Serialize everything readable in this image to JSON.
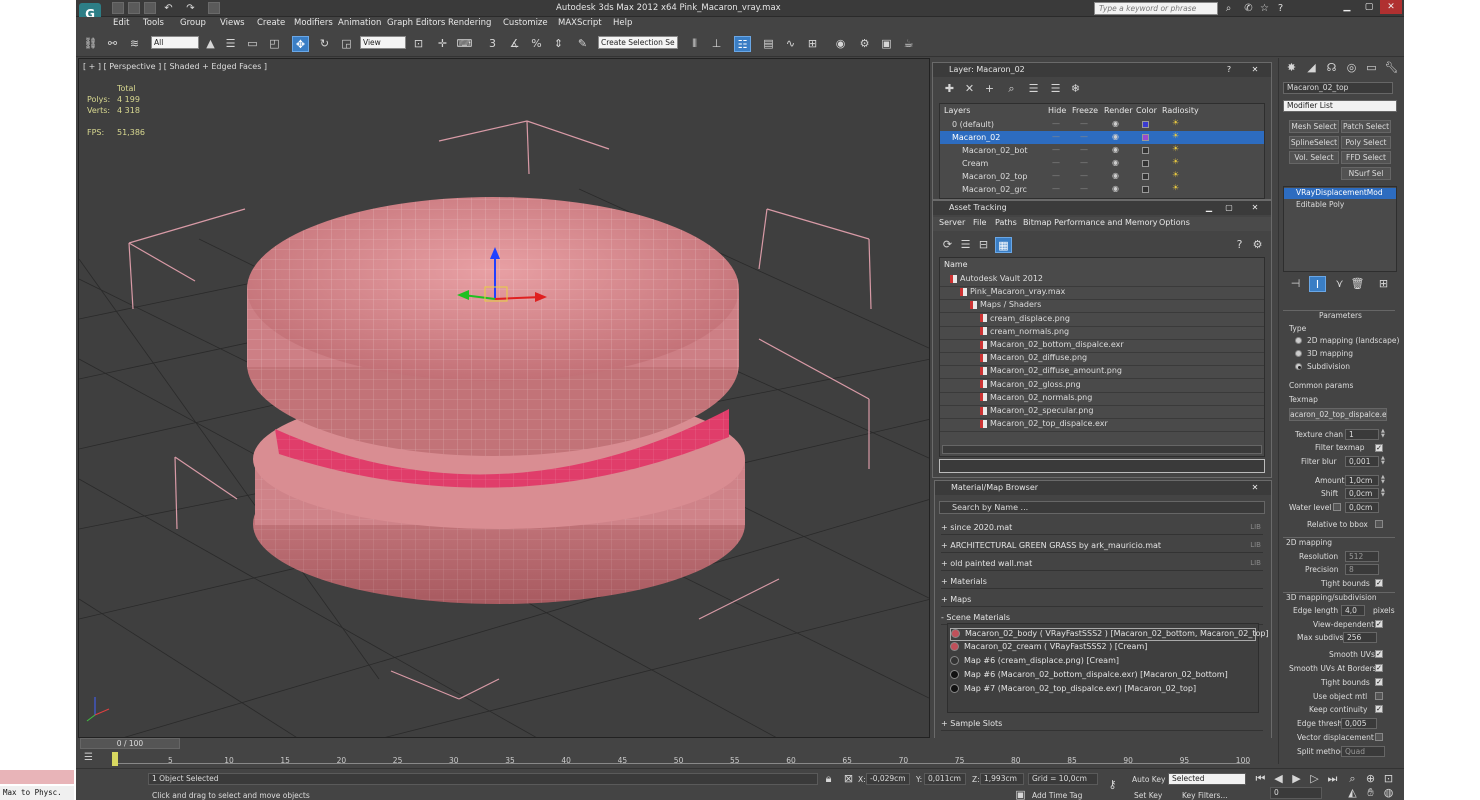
{
  "app": {
    "title": "Autodesk 3ds Max  2012 x64      Pink_Macaron_vray.max",
    "search_placeholder": "Type a keyword or phrase",
    "logo": "G"
  },
  "menu": [
    "Edit",
    "Tools",
    "Group",
    "Views",
    "Create",
    "Modifiers",
    "Animation",
    "Graph Editors",
    "Rendering",
    "Customize",
    "MAXScript",
    "Help"
  ],
  "toolbar": {
    "filter_value": "All",
    "ref_coord_value": "View",
    "selection_set_value": "Create Selection Se"
  },
  "viewport": {
    "label": "[ + ] [ Perspective ] [ Shaded + Edged Faces ]",
    "stats": {
      "total_label": "Total",
      "polys_label": "Polys:",
      "polys_value": "4 199",
      "verts_label": "Verts:",
      "verts_value": "4 318",
      "fps_label": "FPS:",
      "fps_value": "51,386"
    }
  },
  "layer_panel": {
    "title": "Layer: Macaron_02",
    "columns": [
      "Layers",
      "Hide",
      "Freeze",
      "Render",
      "Color",
      "Radiosity"
    ],
    "rows": [
      {
        "name": "0 (default)",
        "indent": 0,
        "selected": false,
        "color": "#3a3ad0"
      },
      {
        "name": "Macaron_02",
        "indent": 0,
        "selected": true,
        "color": "#9a4ad0"
      },
      {
        "name": "Macaron_02_bot",
        "indent": 1,
        "selected": false,
        "color": "#333333"
      },
      {
        "name": "Cream",
        "indent": 1,
        "selected": false,
        "color": "#333333"
      },
      {
        "name": "Macaron_02_top",
        "indent": 1,
        "selected": false,
        "color": "#333333"
      },
      {
        "name": "Macaron_02_grc",
        "indent": 1,
        "selected": false,
        "color": "#333333"
      }
    ]
  },
  "asset_panel": {
    "title": "Asset Tracking",
    "menu": [
      "Server",
      "File",
      "Paths",
      "Bitmap Performance and Memory",
      "Options"
    ],
    "column": "Name",
    "rows": [
      {
        "name": "Autodesk Vault 2012",
        "indent": 1
      },
      {
        "name": "Pink_Macaron_vray.max",
        "indent": 2
      },
      {
        "name": "Maps / Shaders",
        "indent": 3
      },
      {
        "name": "cream_displace.png",
        "indent": 4
      },
      {
        "name": "cream_normals.png",
        "indent": 4
      },
      {
        "name": "Macaron_02_bottom_dispalce.exr",
        "indent": 4
      },
      {
        "name": "Macaron_02_diffuse.png",
        "indent": 4
      },
      {
        "name": "Macaron_02_diffuse_amount.png",
        "indent": 4
      },
      {
        "name": "Macaron_02_gloss.png",
        "indent": 4
      },
      {
        "name": "Macaron_02_normals.png",
        "indent": 4
      },
      {
        "name": "Macaron_02_specular.png",
        "indent": 4
      },
      {
        "name": "Macaron_02_top_dispalce.exr",
        "indent": 4
      }
    ]
  },
  "material_browser": {
    "title": "Material/Map Browser",
    "search_placeholder": "Search by Name ...",
    "libraries": [
      {
        "label": "+ since 2020.mat",
        "lib": "LIB"
      },
      {
        "label": "+ ARCHITECTURAL GREEN GRASS by ark_mauricio.mat",
        "lib": "LIB"
      },
      {
        "label": "+ old painted wall.mat",
        "lib": "LIB"
      },
      {
        "label": "+ Materials",
        "lib": ""
      },
      {
        "label": "+ Maps",
        "lib": ""
      },
      {
        "label": "- Scene Materials",
        "lib": ""
      }
    ],
    "scene_materials": [
      {
        "label": "Macaron_02_body  ( VRayFastSSS2 ) [Macaron_02_bottom, Macaron_02_top]",
        "swatch": "#c0505a"
      },
      {
        "label": "Macaron_02_cream  ( VRayFastSSS2 ) [Cream]",
        "swatch": "#c0505a"
      },
      {
        "label": "Map #6 (cream_displace.png) [Cream]",
        "swatch": "#333333"
      },
      {
        "label": "Map #6 (Macaron_02_bottom_dispalce.exr) [Macaron_02_bottom]",
        "swatch": "#111111"
      },
      {
        "label": "Map #7 (Macaron_02_top_dispalce.exr) [Macaron_02_top]",
        "swatch": "#111111"
      }
    ],
    "sample_slots": "+ Sample Slots"
  },
  "command_panel": {
    "object_name": "Macaron_02_top",
    "modifier_list": "Modifier List",
    "buttons": [
      "Mesh Select",
      "Patch Select",
      "SplineSelect",
      "Poly Select",
      "Vol. Select",
      "FFD Select",
      "NSurf Sel"
    ],
    "stack": [
      {
        "label": "VRayDisplacementMod",
        "selected": true
      },
      {
        "label": "Editable Poly",
        "selected": false
      }
    ],
    "parameters": {
      "section": "Parameters",
      "type_label": "Type",
      "type_options": [
        "2D mapping (landscape)",
        "3D mapping",
        "Subdivision"
      ],
      "type_selected": 2,
      "common_label": "Common params",
      "texmap_label": "Texmap",
      "texmap_value": "acaron_02_top_dispalce.exr)",
      "texture_chan_label": "Texture chan",
      "texture_chan_value": "1",
      "filter_texmap_label": "Filter texmap",
      "filter_blur_label": "Filter blur",
      "filter_blur_value": "0,001",
      "amount_label": "Amount",
      "amount_value": "1,0cm",
      "shift_label": "Shift",
      "shift_value": "0,0cm",
      "water_level_label": "Water level",
      "water_level_value": "0,0cm",
      "relative_bbox_label": "Relative to bbox",
      "mapping2d_label": "2D mapping",
      "resolution_label": "Resolution",
      "resolution_value": "512",
      "precision_label": "Precision",
      "precision_value": "8",
      "tight_bounds_label": "Tight bounds",
      "mapping3d_label": "3D mapping/subdivision",
      "edge_length_label": "Edge length",
      "edge_length_value": "4,0",
      "pixels_label": "pixels",
      "view_dependent_label": "View-dependent",
      "max_subdivs_label": "Max subdivs",
      "max_subdivs_value": "256",
      "smooth_uvs_label": "Smooth UVs",
      "smooth_uvs_borders_label": "Smooth UVs At Borders",
      "tight_bounds2_label": "Tight bounds",
      "use_object_mtl_label": "Use object mtl",
      "keep_continuity_label": "Keep continuity",
      "edge_thresh_label": "Edge thresh",
      "edge_thresh_value": "0,005",
      "vector_disp_label": "Vector displacement",
      "split_method_label": "Split method",
      "split_method_value": "Quad"
    }
  },
  "timeline": {
    "frame": "0 / 100",
    "ticks": [
      "5",
      "10",
      "15",
      "20",
      "25",
      "30",
      "35",
      "40",
      "45",
      "50",
      "55",
      "60",
      "65",
      "70",
      "75",
      "80",
      "85",
      "90",
      "95",
      "100"
    ]
  },
  "status": {
    "maxscript": "Max to Physc.",
    "selected": "1 Object Selected",
    "prompt": "Click and drag to select and move objects",
    "x_label": "X:",
    "x_value": "-0,029cm",
    "y_label": "Y:",
    "y_value": "0,011cm",
    "z_label": "Z:",
    "z_value": "1,993cm",
    "grid": "Grid = 10,0cm",
    "add_time_tag": "Add Time Tag",
    "auto_key": "Auto Key",
    "set_key": "Set Key",
    "selected_dropdown": "Selected",
    "key_filters": "Key Filters...",
    "frame_field": "0"
  }
}
